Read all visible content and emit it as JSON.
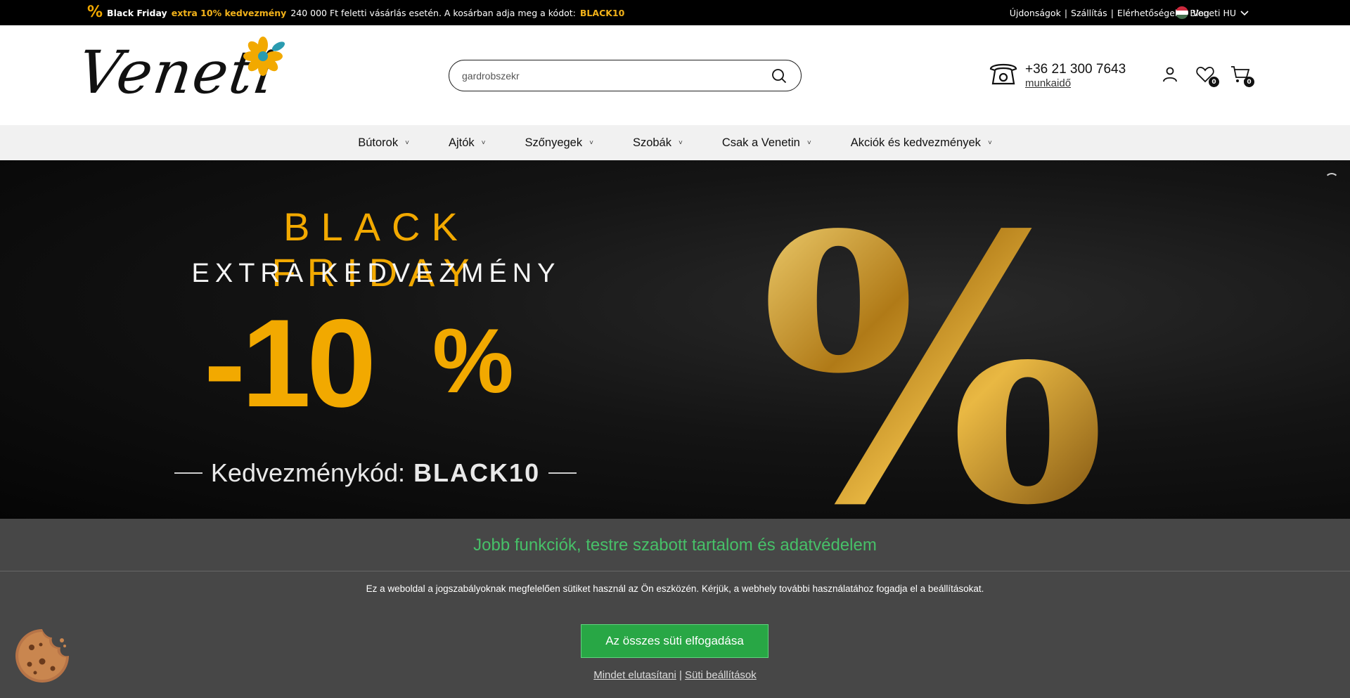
{
  "topbar": {
    "promo_icon": "%",
    "promo_bold": "Black Friday",
    "promo_highlight": "extra 10% kedvezmény",
    "promo_text": "240 000 Ft feletti vásárlás esetén. A kosárban adja meg a kódot:",
    "promo_code": "BLACK10",
    "links": [
      "Újdonságok",
      "Szállítás",
      "Elérhetőségek",
      "Blog"
    ],
    "country_label": "Veneti HU"
  },
  "header": {
    "logo_text": "Veneti",
    "search_value": "gardrobszekr",
    "phone": "+36 21 300 7643",
    "work_hours": "munkaidő",
    "wishlist_count": "0",
    "cart_count": "0"
  },
  "nav": {
    "items": [
      "Bútorok",
      "Ajtók",
      "Szőnyegek",
      "Szobák",
      "Csak a Venetin",
      "Akciók és kedvezmények"
    ]
  },
  "banner": {
    "title": "BLACK FRIDAY",
    "subtitle": "EXTRA KEDVEZMÉNY",
    "discount": "-10",
    "percent": "%",
    "code_label": "Kedvezménykód:",
    "code": "BLACK10",
    "big_symbol": "%"
  },
  "consent": {
    "title": "Jobb funkciók, testre szabott tartalom és adatvédelem",
    "text": "Ez a weboldal a jogszabályoknak megfelelően sütiket használ az Ön eszközén. Kérjük, a webhely további használatához fogadja el a beállításokat.",
    "accept": "Az összes süti elfogadása",
    "reject": "Mindet elutasítani",
    "separator": "|",
    "settings": "Süti beállítások"
  },
  "colors": {
    "brand_gold": "#f2a900",
    "consent_green": "#28a745",
    "consent_title": "#47c068"
  }
}
